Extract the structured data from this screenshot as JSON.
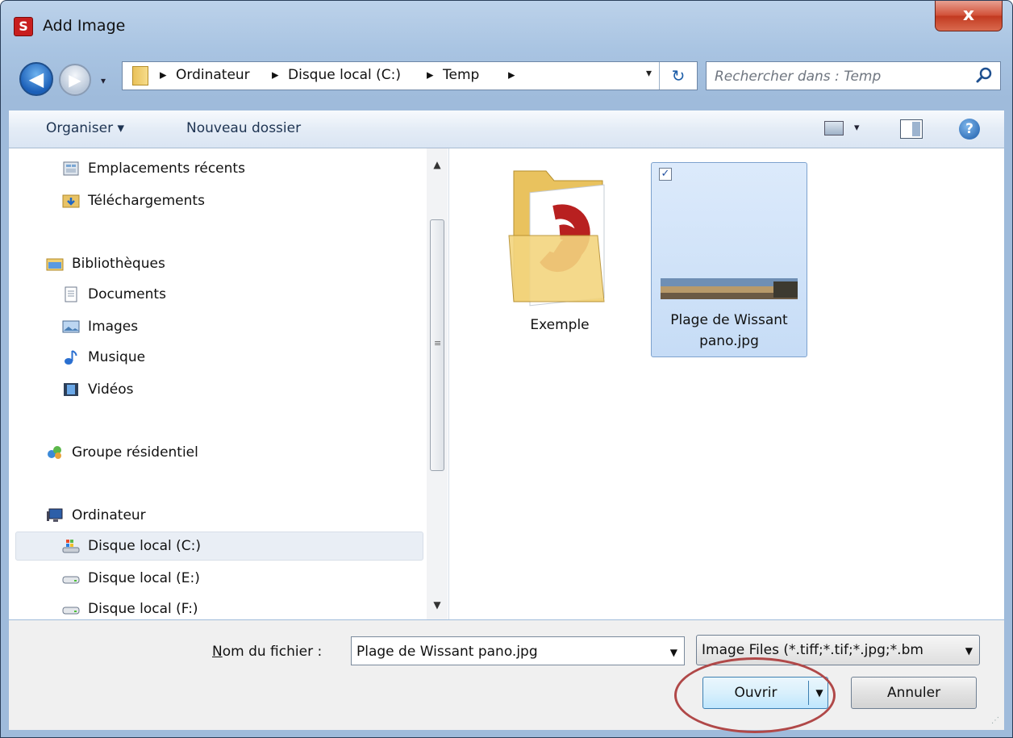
{
  "window": {
    "title": "Add Image",
    "app_icon_letter": "S",
    "close_label": "x"
  },
  "nav": {
    "back_label": "◀",
    "forward_label": "▶",
    "history_dropdown": "▾",
    "address_segments": [
      "Ordinateur",
      "Disque local (C:)",
      "Temp"
    ],
    "breadcrumb_separator": "▸",
    "address_dropdown": "▾",
    "refresh_label": "↻"
  },
  "search": {
    "placeholder": "Rechercher dans : Temp"
  },
  "toolbar": {
    "organize": "Organiser ▾",
    "new_folder": "Nouveau dossier",
    "view_dropdown": "▾",
    "help": "?"
  },
  "sidebar": {
    "items": [
      {
        "label": "Emplacements récents",
        "icon": "recent-places-icon"
      },
      {
        "label": "Téléchargements",
        "icon": "downloads-folder-icon"
      },
      {
        "label": "Bibliothèques",
        "icon": "libraries-icon"
      },
      {
        "label": "Documents",
        "icon": "documents-icon"
      },
      {
        "label": "Images",
        "icon": "pictures-icon"
      },
      {
        "label": "Musique",
        "icon": "music-icon"
      },
      {
        "label": "Vidéos",
        "icon": "videos-icon"
      },
      {
        "label": "Groupe résidentiel",
        "icon": "homegroup-icon"
      },
      {
        "label": "Ordinateur",
        "icon": "computer-icon"
      },
      {
        "label": "Disque local (C:)",
        "icon": "system-drive-icon",
        "selected": true
      },
      {
        "label": "Disque local (E:)",
        "icon": "drive-icon"
      },
      {
        "label": "Disque local (F:)",
        "icon": "drive-icon"
      }
    ],
    "scroll_up": "▲",
    "scroll_down": "▼",
    "scroll_grip": "≡"
  },
  "files": [
    {
      "name": "Exemple",
      "type": "folder"
    },
    {
      "name_line1": "Plage de Wissant",
      "name_line2": "pano.jpg",
      "type": "image",
      "selected": true,
      "checked": true
    }
  ],
  "checkbox_mark": "✓",
  "footer": {
    "filename_label_first": "N",
    "filename_label_rest": "om du fichier :",
    "filename_value": "Plage de Wissant pano.jpg",
    "filename_dropdown": "▼",
    "filter_value": "Image Files (*.tiff;*.tif;*.jpg;*.bm",
    "filter_dropdown": "▼",
    "open_label": "Ouvrir",
    "open_dropdown": "▼",
    "cancel_label": "Annuler",
    "size_grip": "⋰"
  },
  "colors": {
    "accent": "#3c7fb1",
    "annotation": "#b04848",
    "close": "#c23a21"
  }
}
